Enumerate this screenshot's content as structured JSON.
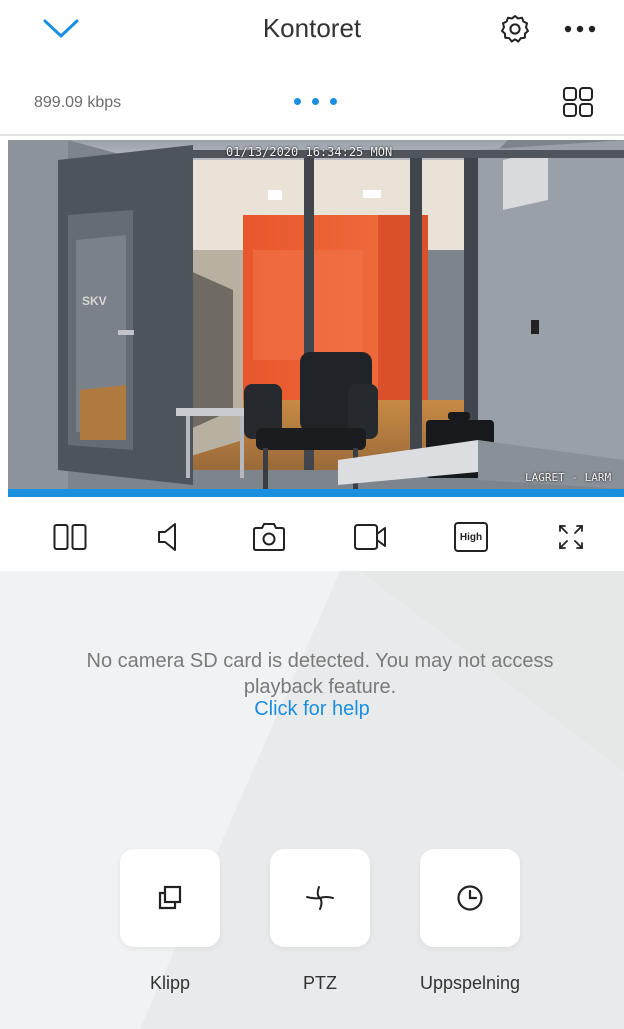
{
  "header": {
    "title": "Kontoret",
    "icons": {
      "back": "chevron-down-icon",
      "settings": "gear-icon",
      "more": "more-dots-icon"
    }
  },
  "subbar": {
    "bitrate": "899.09 kbps",
    "page_indicator": {
      "count": 3,
      "active": 1
    },
    "layout_icon": "grid-icon"
  },
  "video": {
    "timestamp": "01/13/2020 16:34:25 MON",
    "sign_text": "SKV",
    "watermark": "LAGRET - LARM"
  },
  "controls": [
    {
      "name": "split-view-icon"
    },
    {
      "name": "speaker-icon"
    },
    {
      "name": "snapshot-icon"
    },
    {
      "name": "record-icon"
    },
    {
      "name": "quality-button",
      "label": "High"
    },
    {
      "name": "fullscreen-icon"
    }
  ],
  "panel": {
    "notice": "No camera SD card is detected. You may not access playback feature.",
    "help_link": "Click for help",
    "tiles": [
      {
        "label": "Klipp",
        "icon": "clips-icon"
      },
      {
        "label": "PTZ",
        "icon": "ptz-icon"
      },
      {
        "label": "Uppspelning",
        "icon": "clock-icon"
      }
    ]
  },
  "colors": {
    "accent": "#1a8fe0",
    "panel_bg": "#f1f2f3",
    "text": "#333333",
    "muted": "#7a7a7a"
  }
}
